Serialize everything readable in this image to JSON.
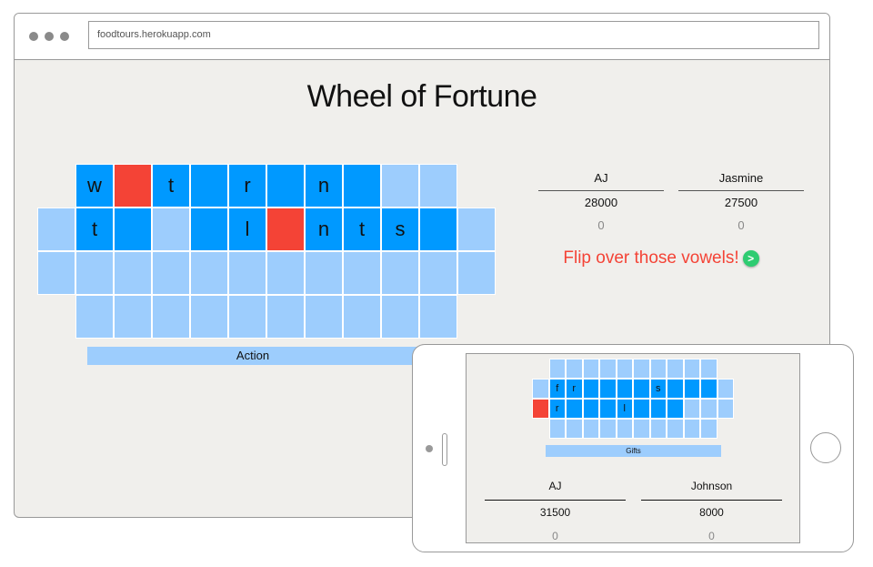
{
  "browser": {
    "url": "foodtours.herokuapp.com"
  },
  "game": {
    "title": "Wheel of Fortune",
    "category": "Action",
    "board_rows": [
      [
        "",
        "w",
        "",
        "t",
        "",
        "r",
        "",
        "n",
        "",
        "",
        ""
      ],
      [
        "t",
        "",
        "",
        "",
        "",
        "l",
        "",
        "n",
        "t",
        "s"
      ],
      [
        "",
        "",
        "",
        "",
        "",
        "",
        "",
        "",
        "",
        "",
        ""
      ],
      [
        "",
        "",
        "",
        "",
        "",
        "",
        "",
        "",
        "",
        "",
        ""
      ]
    ],
    "players": [
      {
        "name": "AJ",
        "score": "28000",
        "round": "0"
      },
      {
        "name": "Jasmine",
        "score": "27500",
        "round": "0"
      }
    ],
    "message": "Flip over those vowels!",
    "go_label": ">",
    "colors": {
      "tile": "#0099ff",
      "empty": "#9dcdfd",
      "highlight": "#f44336",
      "message": "#f44336",
      "button": "#2ecc71"
    }
  },
  "phone_game": {
    "category": "Gifts",
    "board_rows": [
      [
        "f",
        "r",
        "",
        "",
        "",
        "",
        "s",
        "",
        ""
      ],
      [
        "",
        "r",
        "",
        "",
        "",
        "l",
        "",
        "",
        ""
      ]
    ],
    "players": [
      {
        "name": "AJ",
        "score": "31500",
        "round": "0"
      },
      {
        "name": "Johnson",
        "score": "8000",
        "round": "0"
      }
    ]
  }
}
